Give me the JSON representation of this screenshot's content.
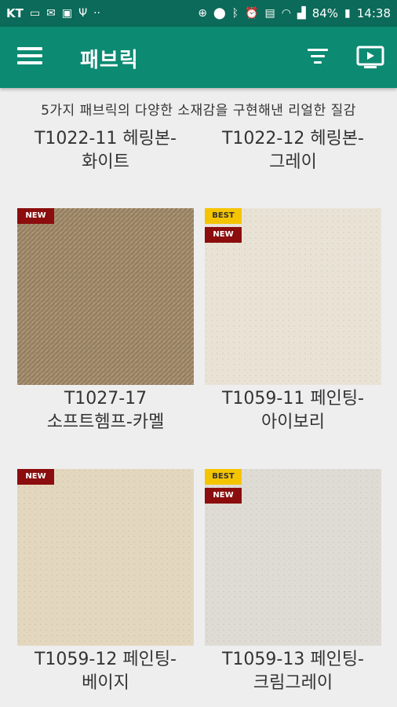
{
  "status_bar": {
    "carrier": "KT",
    "battery": "84%",
    "time": "14:38"
  },
  "app_bar": {
    "title": "패브릭",
    "menu_icon": "menu-icon",
    "filter_icon": "filter-icon",
    "cast_icon": "tv-play-icon"
  },
  "subtitle": "5가지 패브릭의 다양한 소재감을 구현해낸 리얼한 질감",
  "products": [
    {
      "line1": "T1022-11 헤링본-",
      "line2": "화이트"
    },
    {
      "line1": "T1022-12 헤링본-",
      "line2": "그레이"
    },
    {
      "line1": "T1027-17",
      "line2": "소프트헴프-카멜",
      "badges": [
        "NEW"
      ],
      "color": "#a08a6c"
    },
    {
      "line1": "T1059-11 페인팅-",
      "line2": "아이보리",
      "badges": [
        "BEST",
        "NEW"
      ],
      "color": "#e8e2d4"
    },
    {
      "line1": "T1059-12 페인팅-",
      "line2": "베이지",
      "badges": [
        "NEW"
      ],
      "color": "#e2d7bd"
    },
    {
      "line1": "T1059-13 페인팅-",
      "line2": "크림그레이",
      "badges": [
        "BEST",
        "NEW"
      ],
      "color": "#dedbd3"
    }
  ]
}
